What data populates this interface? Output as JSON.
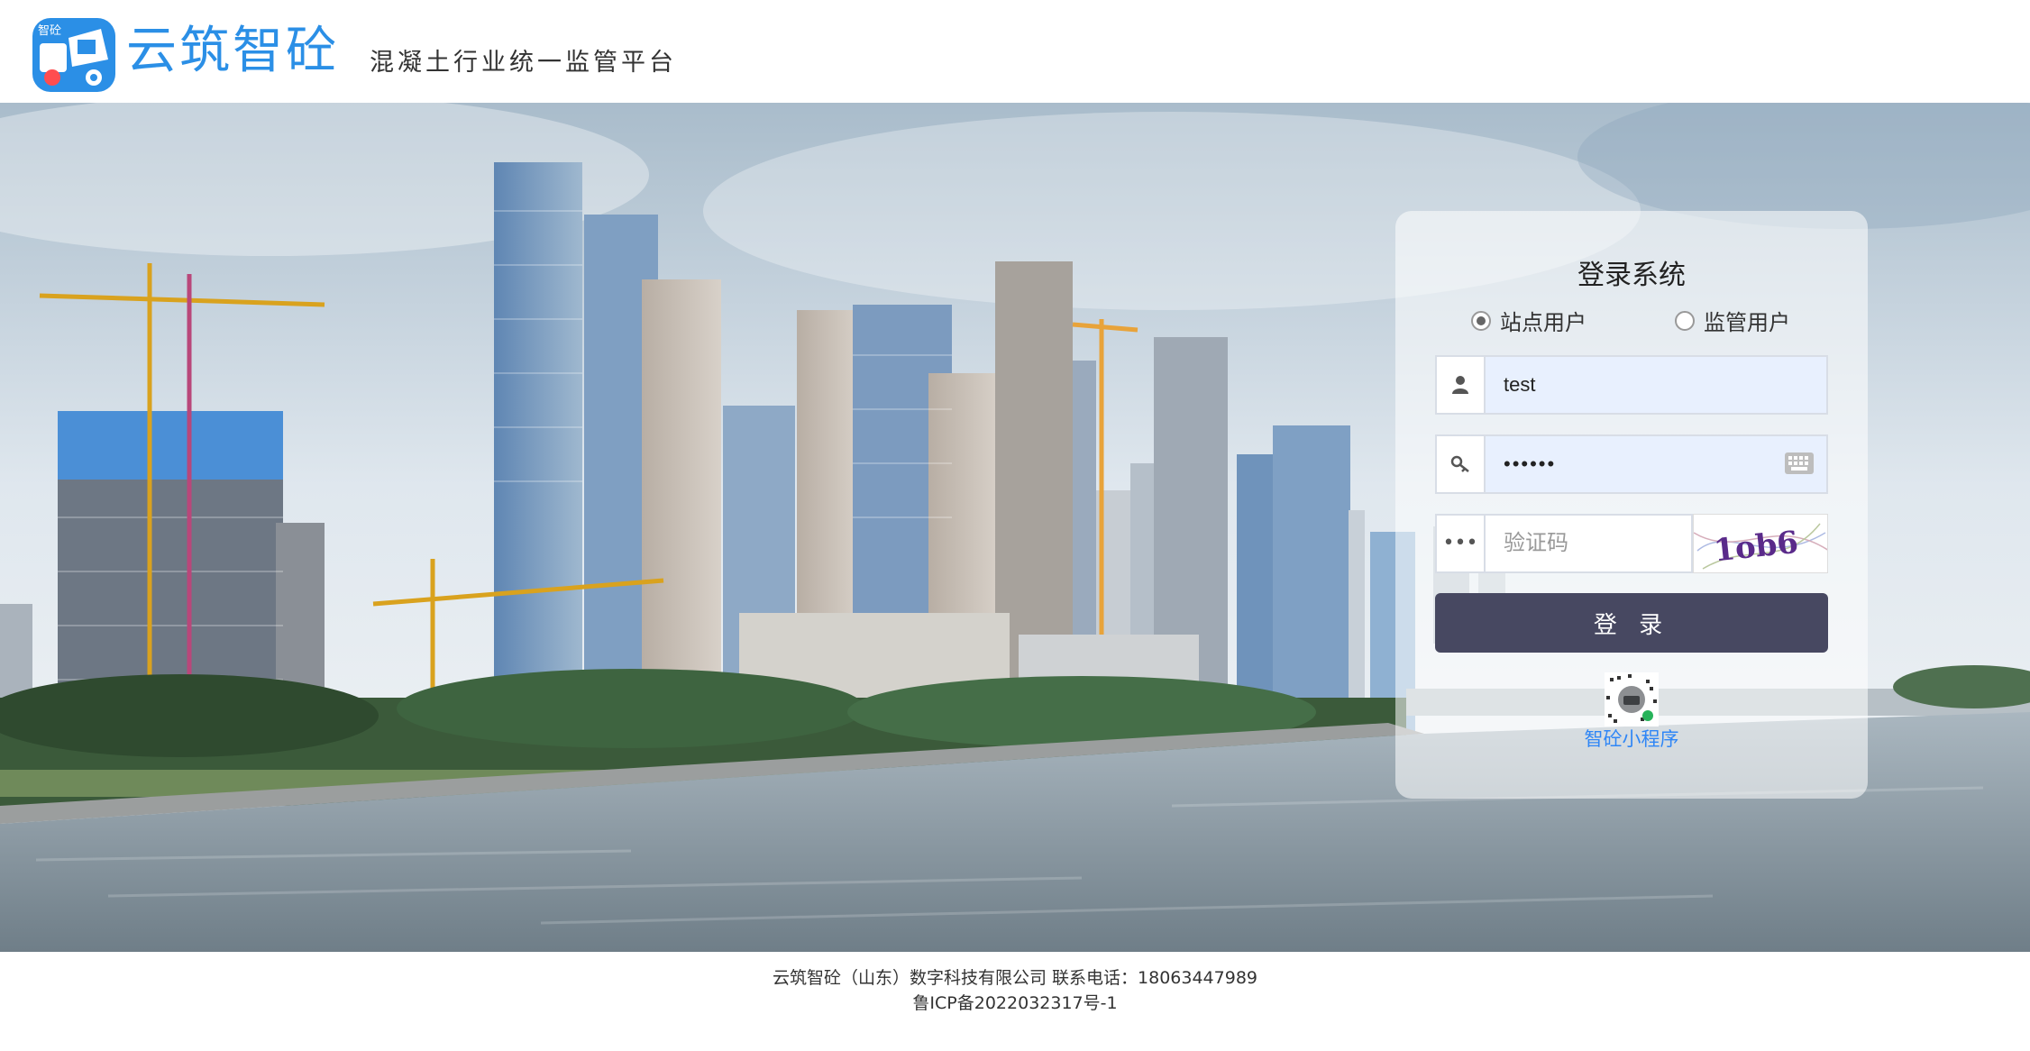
{
  "header": {
    "brand_name": "云筑智砼",
    "logo_badge": "智砼",
    "slogan": "混凝土行业统一监管平台"
  },
  "login": {
    "title": "登录系统",
    "user_types": [
      {
        "label": "站点用户",
        "checked": true
      },
      {
        "label": "监管用户",
        "checked": false
      }
    ],
    "username": {
      "value": "test",
      "icon": "user-icon"
    },
    "password": {
      "value": "••••••",
      "icon": "key-icon",
      "keyboard_icon": "keyboard-icon"
    },
    "captcha": {
      "placeholder": "验证码",
      "icon": "ellipsis-icon",
      "image_text": "1ob6"
    },
    "submit_label": "登 录",
    "mini_program_label": "智砼小程序"
  },
  "footer": {
    "line1": "云筑智砼（山东）数字科技有限公司 联系电话：18063447989",
    "line2": "鲁ICP备2022032317号-1"
  },
  "colors": {
    "brand_blue": "#2b8fe6",
    "login_button": "#474861",
    "link_blue": "#2f86f6",
    "input_fill": "#e8f0fe"
  }
}
